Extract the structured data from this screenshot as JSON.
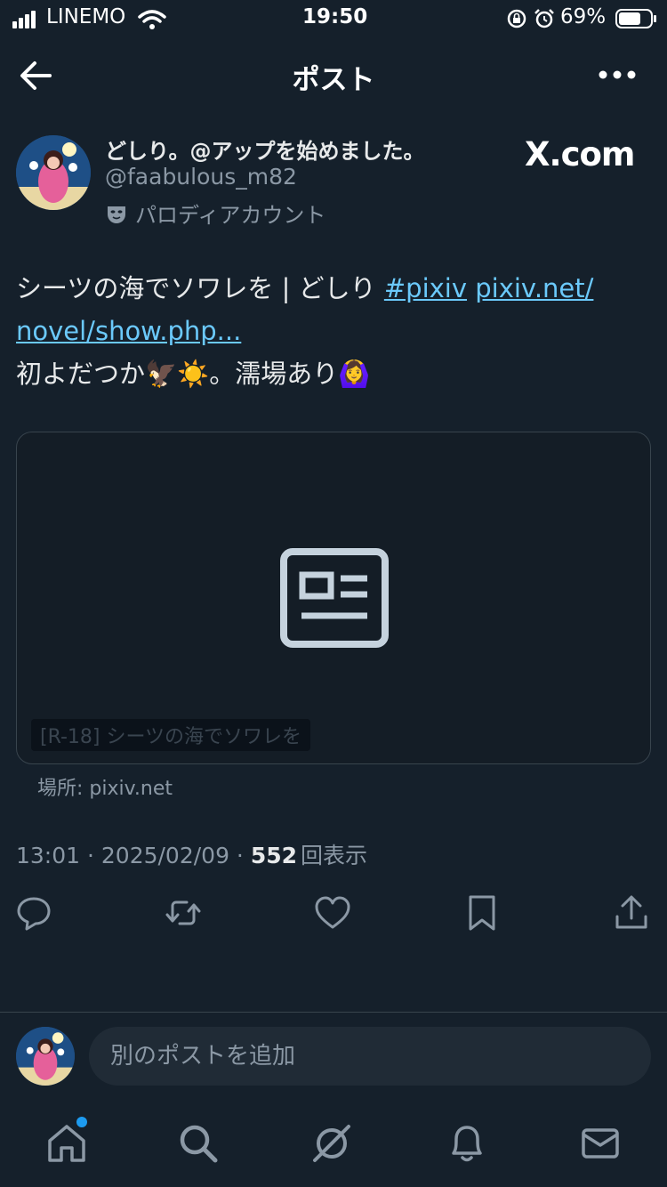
{
  "status_bar": {
    "carrier": "LINEMO",
    "time": "19:50",
    "battery": "69%"
  },
  "header": {
    "title": "ポスト"
  },
  "author": {
    "name": "どしり。@アップを始めました。",
    "handle": "@faabulous_m82",
    "label": "パロディアカウント",
    "badge": "X.com"
  },
  "post": {
    "text_1": "シーツの海でソワレを | どしり ",
    "hashtag": "#pixiv",
    "link_1": "pixiv.net/",
    "link_2": "novel/show.php...",
    "text_2": "初よだつか🦅☀️。濡場あり🙆‍♀️"
  },
  "card": {
    "title": "[R-18] シーツの海でソワレを",
    "domain": "場所: pixiv.net"
  },
  "meta": {
    "time": "13:01",
    "date": "2025/02/09",
    "views": "552",
    "views_label": "回表示"
  },
  "reply": {
    "placeholder": "別のポストを追加"
  },
  "colors": {
    "background": "#15202b",
    "link": "#6bc9fb",
    "accent": "#1d9bf0"
  }
}
